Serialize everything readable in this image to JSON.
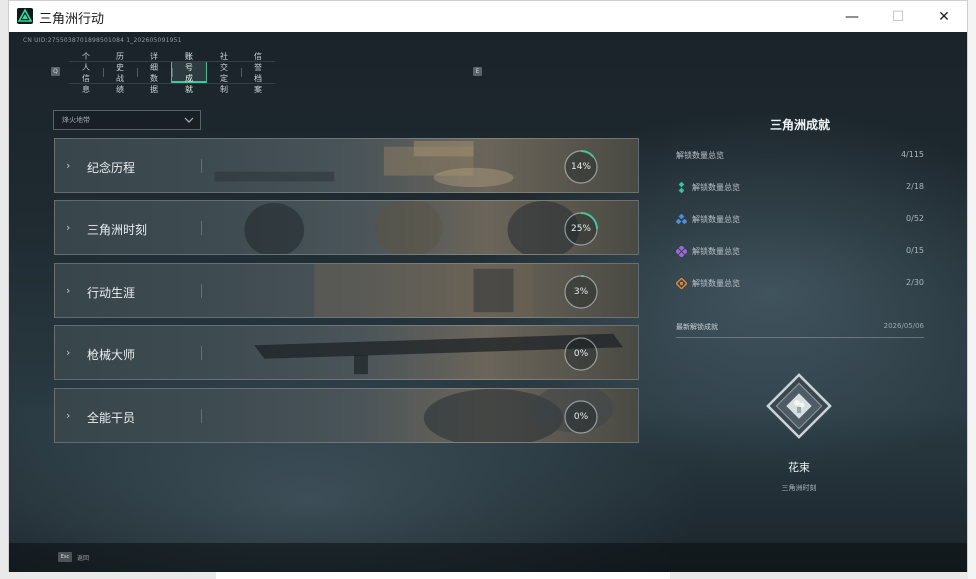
{
  "window": {
    "title": "三角洲行动",
    "minimize_label": "—",
    "maximize_label": "☐",
    "close_label": "✕"
  },
  "game": {
    "uid_text": "CN UID:2755038701898501084 1_202605091951",
    "tabs": [
      {
        "label": "个人信息",
        "active": false
      },
      {
        "label": "历史战绩",
        "active": false
      },
      {
        "label": "详细数据",
        "active": false
      },
      {
        "label": "账号成就",
        "active": true
      },
      {
        "label": "社交定制",
        "active": false
      },
      {
        "label": "信誉档案",
        "active": false
      }
    ],
    "tab_prev_key": "Q",
    "tab_next_key": "E",
    "filter": {
      "selected": "烽火地带"
    },
    "categories": [
      {
        "name": "纪念历程",
        "percent_label": "14%",
        "progress": 0.14
      },
      {
        "name": "三角洲时刻",
        "percent_label": "25%",
        "progress": 0.25
      },
      {
        "name": "行动生涯",
        "percent_label": "3%",
        "progress": 0.03
      },
      {
        "name": "枪械大师",
        "percent_label": "0%",
        "progress": 0.0
      },
      {
        "name": "全能干员",
        "percent_label": "0%",
        "progress": 0.0
      }
    ],
    "summary": {
      "title": "三角洲成就",
      "total": {
        "label": "解锁数量总览",
        "value": "4/115"
      },
      "tiers": [
        {
          "label": "解锁数量总览",
          "value": "2/18",
          "color": "#39c29b",
          "icon": "green-tier-icon"
        },
        {
          "label": "解锁数量总览",
          "value": "0/52",
          "color": "#4f8fd6",
          "icon": "blue-tier-icon"
        },
        {
          "label": "解锁数量总览",
          "value": "0/15",
          "color": "#9b6ad6",
          "icon": "purple-tier-icon"
        },
        {
          "label": "解锁数量总览",
          "value": "2/30",
          "color": "#e0843a",
          "icon": "orange-tier-icon"
        }
      ]
    },
    "recent": {
      "header": "最新解锁成就",
      "date": "2026/05/06",
      "badge_name": "花束",
      "badge_category": "三角洲时刻"
    },
    "back": {
      "key": "Esc",
      "label": "返回"
    }
  },
  "colors": {
    "accent": "#45c59d",
    "progress_ring": "#45c59d"
  }
}
